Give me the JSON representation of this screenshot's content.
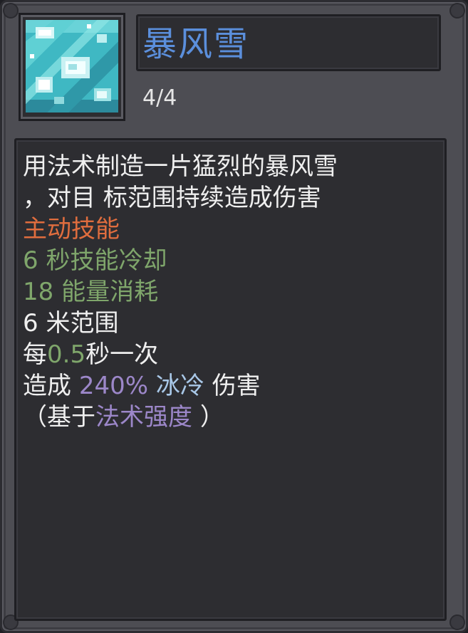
{
  "skill": {
    "name": "暴风雪",
    "level": "4/4",
    "icon": "blizzard-icon"
  },
  "description": {
    "line1": "用法术制造一片猛烈的暴风雪",
    "line2": "，对目 标范围持续造成伤害",
    "type_label": "主动技能",
    "cooldown": "6 秒技能冷却",
    "cost": "18 能量消耗",
    "range": "6 米范围",
    "tick_prefix": "每",
    "tick_value": "0.5",
    "tick_suffix": "秒一次",
    "damage_prefix": "造成",
    "damage_percent": "240%",
    "damage_element": "冰冷",
    "damage_suffix": "伤害",
    "scaling_open": "（基于",
    "scaling_stat": "法术强度",
    "scaling_close": "）"
  },
  "colors": {
    "title": "#5b8fdc",
    "active_skill": "#e06d3e",
    "stat_green": "#7fa66b",
    "percent_purple": "#9c87c9",
    "ice_blue": "#a9c8e8"
  }
}
